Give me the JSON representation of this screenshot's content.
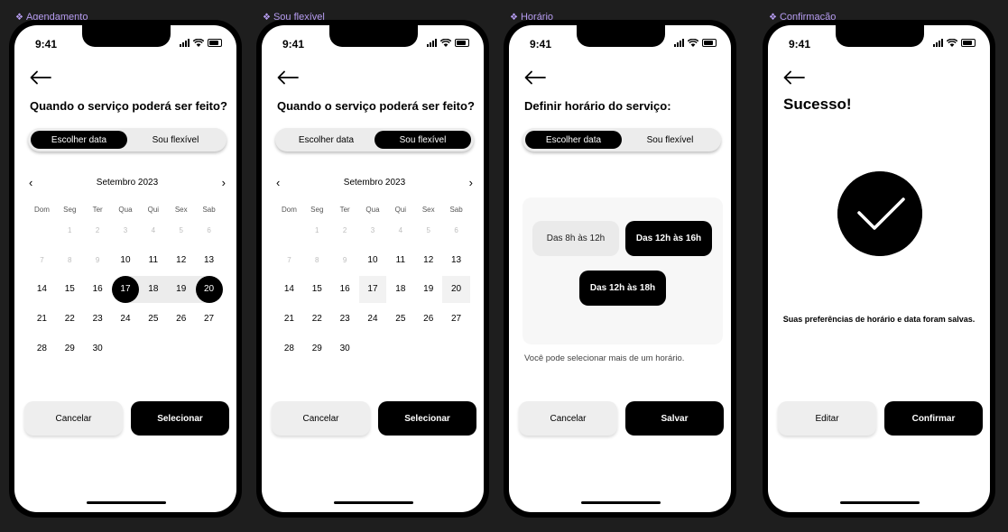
{
  "status": {
    "time": "9:41"
  },
  "frames": [
    {
      "label": "Agendamento",
      "title": "Quando o serviço poderá ser feito?",
      "segment": [
        "Escolher data",
        "Sou flexível"
      ],
      "calendar": {
        "month": "Setembro 2023",
        "prev": "‹",
        "next": "›",
        "weekdays": [
          "Dom",
          "Seg",
          "Ter",
          "Qua",
          "Qui",
          "Sex",
          "Sab"
        ],
        "weeks": [
          [
            "",
            "1",
            "2",
            "3",
            "4",
            "5",
            "6"
          ],
          [
            "7",
            "8",
            "9",
            "10",
            "11",
            "12",
            "13"
          ],
          [
            "14",
            "15",
            "16",
            "17",
            "18",
            "19",
            "20"
          ],
          [
            "21",
            "22",
            "23",
            "24",
            "25",
            "26",
            "27"
          ],
          [
            "28",
            "29",
            "30",
            "",
            "",
            "",
            ""
          ]
        ]
      },
      "cancel": "Cancelar",
      "confirm": "Selecionar"
    },
    {
      "label": "Sou flexível",
      "title": "Quando o serviço poderá ser feito?",
      "segment": [
        "Escolher data",
        "Sou flexível"
      ],
      "calendar": {
        "month": "Setembro 2023",
        "prev": "‹",
        "next": "›",
        "weekdays": [
          "Dom",
          "Seg",
          "Ter",
          "Qua",
          "Qui",
          "Sex",
          "Sab"
        ],
        "weeks": [
          [
            "",
            "1",
            "2",
            "3",
            "4",
            "5",
            "6"
          ],
          [
            "7",
            "8",
            "9",
            "10",
            "11",
            "12",
            "13"
          ],
          [
            "14",
            "15",
            "16",
            "17",
            "18",
            "19",
            "20"
          ],
          [
            "21",
            "22",
            "23",
            "24",
            "25",
            "26",
            "27"
          ],
          [
            "28",
            "29",
            "30",
            "",
            "",
            "",
            ""
          ]
        ]
      },
      "cancel": "Cancelar",
      "confirm": "Selecionar"
    },
    {
      "label": "Horário",
      "title": "Definir horário do serviço:",
      "segment": [
        "Escolher data",
        "Sou flexível"
      ],
      "slots": [
        "Das 8h às 12h",
        "Das 12h às 16h",
        "Das 12h às 18h"
      ],
      "hint": "Você pode selecionar mais de um horário.",
      "cancel": "Cancelar",
      "confirm": "Salvar"
    },
    {
      "label": "Confirmação",
      "title": "Sucesso!",
      "message": "Suas preferências de horário e data foram salvas.",
      "cancel": "Editar",
      "confirm": "Confirmar"
    }
  ]
}
